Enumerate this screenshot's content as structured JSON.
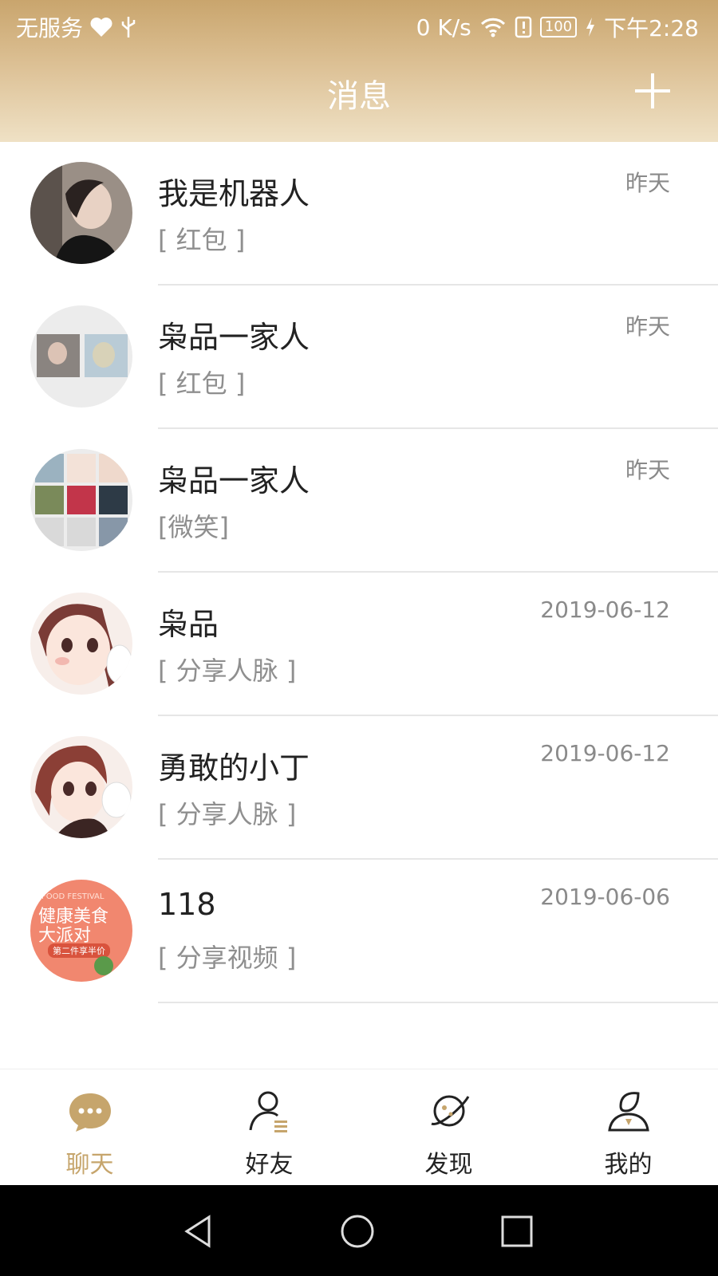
{
  "status_bar": {
    "left_text": "无服务",
    "speed": "0 K/s",
    "battery": "100",
    "time": "下午2:28",
    "icons": [
      "heart-icon",
      "usb-icon",
      "wifi-icon",
      "sim-alert-icon",
      "battery-icon",
      "charging-icon"
    ]
  },
  "header": {
    "title": "消息",
    "add_icon": "plus-icon"
  },
  "chats": [
    {
      "name": "我是机器人",
      "preview": "[ 红包 ]",
      "date": "昨天"
    },
    {
      "name": "枭品一家人",
      "preview": "[ 红包 ]",
      "date": "昨天"
    },
    {
      "name": "枭品一家人",
      "preview": "[微笑]",
      "date": "昨天"
    },
    {
      "name": "枭品",
      "preview": "[ 分享人脉 ]",
      "date": "2019-06-12"
    },
    {
      "name": "勇敢的小丁",
      "preview": "[ 分享人脉 ]",
      "date": "2019-06-12"
    },
    {
      "name": "118",
      "preview": "[ 分享视频 ]",
      "date": "2019-06-06"
    }
  ],
  "avatar6_texts": {
    "line1": "FOOD FESTIVAL",
    "line2": "健康美食",
    "line3": "大派对",
    "line4": "第二件享半价"
  },
  "tabs": [
    {
      "label": "聊天",
      "icon": "chat-bubble-icon",
      "active": true
    },
    {
      "label": "好友",
      "icon": "friends-icon",
      "active": false
    },
    {
      "label": "发现",
      "icon": "planet-icon",
      "active": false
    },
    {
      "label": "我的",
      "icon": "profile-icon",
      "active": false
    }
  ],
  "colors": {
    "accent": "#c6a56c",
    "header_top": "#c9a56d",
    "header_bottom": "#efe1c5"
  }
}
